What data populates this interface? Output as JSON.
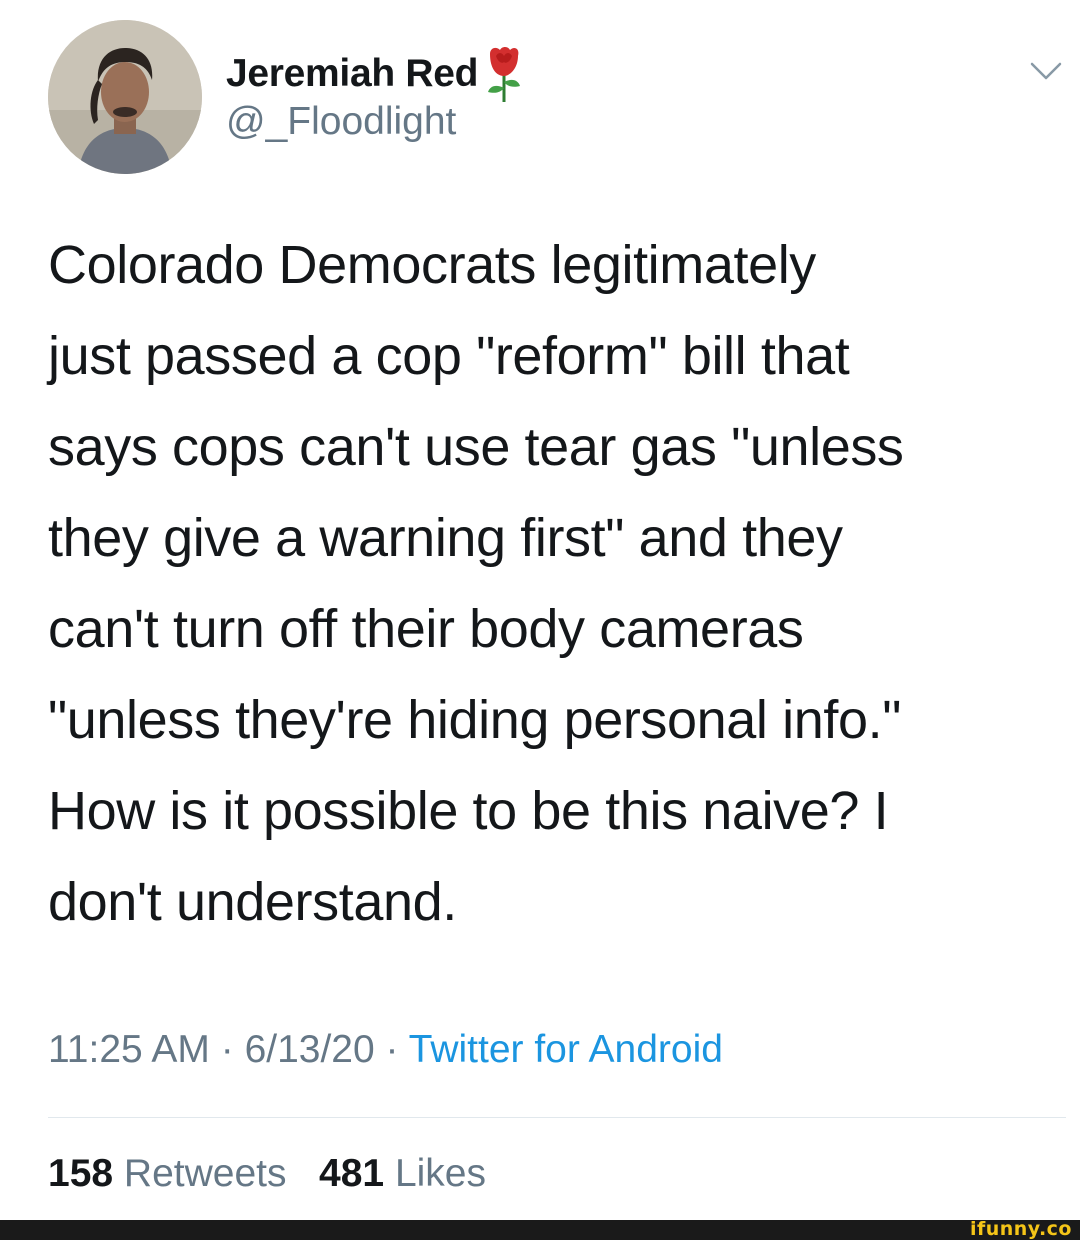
{
  "tweet": {
    "display_name": "Jeremiah Red",
    "handle": "@_Floodlight",
    "text": "Colorado Democrats legitimately\njust passed a cop \"reform\" bill that\nsays cops can't use tear gas \"unless\nthey give a warning first\" and they\ncan't turn off their body cameras\n\"unless they're hiding personal info.\"\nHow is it possible to be this naive? I\ndon't understand.",
    "time": "11:25 AM",
    "date": "6/13/20",
    "separator": " · ",
    "source": "Twitter for Android",
    "retweets_count": "158",
    "retweets_label": "Retweets",
    "likes_count": "481",
    "likes_label": "Likes"
  },
  "icons": {
    "name_badge": "rose-icon",
    "menu": "chevron-down-icon",
    "avatar": "avatar-photo"
  },
  "colors": {
    "text_primary": "#14171a",
    "text_secondary": "#657786",
    "link": "#1b95e0",
    "divider": "#e1e8ed",
    "footer": "#1a1a1a",
    "watermark": "#f5c518"
  },
  "watermark": "ifunny.co"
}
